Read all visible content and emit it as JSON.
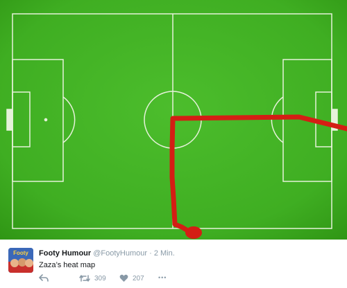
{
  "pitch": {
    "grass_light": "#3fae22",
    "grass_dark": "#2f9514",
    "line_color": "#e6f2da",
    "path_color": "#d41e14"
  },
  "tweet": {
    "avatar_icon": "footy-humour-logo",
    "avatar_text": "Footy",
    "name": "Footy Humour",
    "handle": "@FootyHumour",
    "separator": "·",
    "time": "2 Min.",
    "text": "Zaza’s heat map",
    "actions": {
      "reply_icon": "reply-icon",
      "retweet_icon": "retweet-icon",
      "retweet_count": "309",
      "like_icon": "heart-icon",
      "like_count": "207",
      "more_icon": "more-icon",
      "more_label": "•••"
    }
  }
}
